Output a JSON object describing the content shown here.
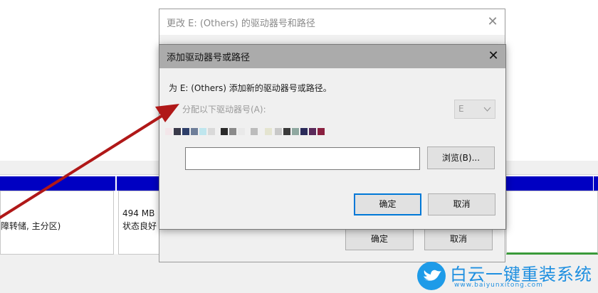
{
  "background_window": {
    "left_partition_text": "障转储, 主分区)",
    "right_partition_size": "494 MB",
    "right_partition_status": "状态良好",
    "ok_label": "确定",
    "cancel_label": "取消"
  },
  "change_dialog": {
    "title": "更改 E: (Others) 的驱动器号和路径",
    "close_glyph": "✕"
  },
  "add_dialog": {
    "title": "添加驱动器号或路径",
    "close_glyph": "✕",
    "instruction": "为 E: (Others) 添加新的驱动器号或路径。",
    "assign_option_label": "分配以下驱动器号(A):",
    "drive_letter_value": "E",
    "path_input_value": "",
    "browse_label": "浏览(B)...",
    "ok_label": "确定",
    "cancel_label": "取消"
  },
  "watermark": {
    "brand": "白云一键重装系统",
    "url": "www.baiyunxitong.com"
  },
  "colors": {
    "accent_blue": "#0078d7",
    "partition_header_blue": "#0000c2",
    "annotation_arrow": "#b01818",
    "watermark_blue": "#1e8fe0"
  }
}
